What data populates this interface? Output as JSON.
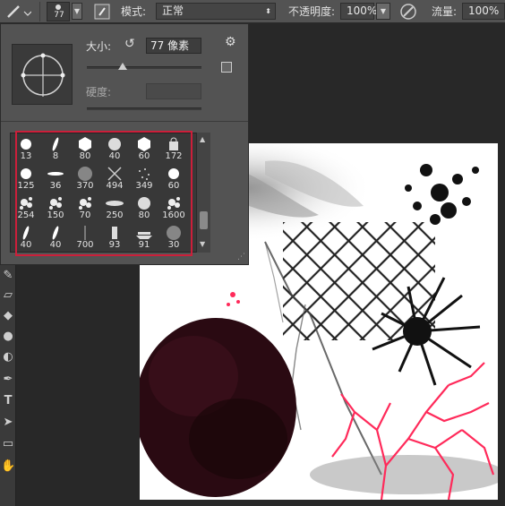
{
  "options_bar": {
    "brush_size": "77",
    "mode_label": "模式:",
    "mode_value": "正常",
    "opacity_label": "不透明度:",
    "opacity_value": "100%",
    "flow_label": "流量:",
    "flow_value": "100%"
  },
  "brush_panel": {
    "size_label": "大小:",
    "size_value": "77 像素",
    "hardness_label": "硬度:",
    "size_slider_fraction": 0.31
  },
  "presets": [
    {
      "num": "13",
      "shape": "round-hard"
    },
    {
      "num": "8",
      "shape": "leaf"
    },
    {
      "num": "80",
      "shape": "hex"
    },
    {
      "num": "40",
      "shape": "round-soft"
    },
    {
      "num": "60",
      "shape": "hex"
    },
    {
      "num": "172",
      "shape": "bag"
    },
    {
      "num": "125",
      "shape": "round-hard"
    },
    {
      "num": "36",
      "shape": "ellipse"
    },
    {
      "num": "370",
      "shape": "blur"
    },
    {
      "num": "494",
      "shape": "cross"
    },
    {
      "num": "349",
      "shape": "spray"
    },
    {
      "num": "60",
      "shape": "round-hard"
    },
    {
      "num": "254",
      "shape": "splat"
    },
    {
      "num": "150",
      "shape": "splat"
    },
    {
      "num": "70",
      "shape": "splat"
    },
    {
      "num": "250",
      "shape": "streak"
    },
    {
      "num": "80",
      "shape": "round-soft"
    },
    {
      "num": "1600",
      "shape": "splat"
    },
    {
      "num": "40",
      "shape": "leaf"
    },
    {
      "num": "40",
      "shape": "leaf"
    },
    {
      "num": "700",
      "shape": "line"
    },
    {
      "num": "93",
      "shape": "figure"
    },
    {
      "num": "91",
      "shape": "boat"
    },
    {
      "num": "30",
      "shape": "blur"
    }
  ],
  "colors": {
    "panel_bg": "#535353",
    "highlight": "#cc1f3a",
    "canvas_bg": "#282828",
    "pink_brush": "#ff2a5a",
    "dark_brush": "#2a0a12"
  }
}
